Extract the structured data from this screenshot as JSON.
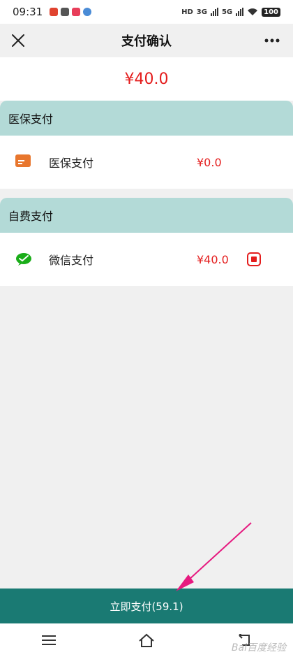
{
  "status_bar": {
    "time": "09:31",
    "battery": "100",
    "net1": "3G",
    "net2": "5G",
    "hd": "HD"
  },
  "header": {
    "title": "支付确认",
    "close_icon": "close-icon",
    "more_icon": "more-icon"
  },
  "total_amount": "¥40.0",
  "sections": [
    {
      "title": "医保支付",
      "items": [
        {
          "name": "医保支付",
          "amount": "¥0.0",
          "icon": "card-icon",
          "icon_color": "#e8762d"
        }
      ]
    },
    {
      "title": "自费支付",
      "items": [
        {
          "name": "微信支付",
          "amount": "¥40.0",
          "icon": "wechat-pay-icon",
          "icon_color": "#1aad19",
          "selected": true
        }
      ]
    }
  ],
  "pay_button": {
    "label": "立即支付(59.1)"
  },
  "nav": {
    "menu_icon": "menu-icon",
    "home_icon": "home-icon",
    "back_icon": "back-icon"
  },
  "watermark": "Bai百度经验",
  "colors": {
    "accent": "#1a7a73",
    "section_bg": "#b3dad7",
    "price": "#e41d1d",
    "arrow": "#e6197f"
  }
}
